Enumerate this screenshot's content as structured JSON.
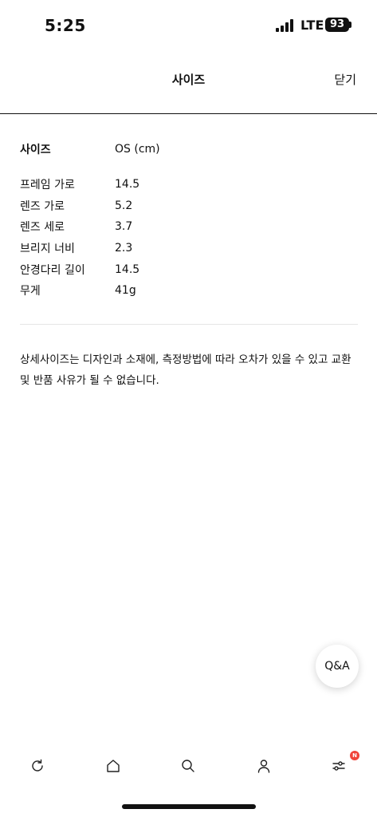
{
  "status_bar": {
    "time": "5:25",
    "network": "LTE",
    "battery": "93"
  },
  "header": {
    "title": "사이즈",
    "close_label": "닫기"
  },
  "size_table": {
    "header_label": "사이즈",
    "header_value": "OS (cm)",
    "rows": [
      {
        "label": "프레임 가로",
        "value": "14.5"
      },
      {
        "label": "렌즈 가로",
        "value": "5.2"
      },
      {
        "label": "렌즈 세로",
        "value": "3.7"
      },
      {
        "label": "브리지 너비",
        "value": "2.3"
      },
      {
        "label": "안경다리 길이",
        "value": "14.5"
      },
      {
        "label": "무게",
        "value": "41g"
      }
    ]
  },
  "notice": "상세사이즈는 디자인과 소재에, 측정방법에 따라 오차가 있을 수 있고 교환 및 반품 사유가 될 수 없습니다.",
  "qa_button": {
    "label": "Q&A"
  },
  "tab_bar": {
    "items": [
      {
        "icon": "refresh-icon"
      },
      {
        "icon": "home-icon"
      },
      {
        "icon": "search-icon"
      },
      {
        "icon": "person-icon"
      },
      {
        "icon": "filter-icon"
      }
    ],
    "badge": "N"
  }
}
